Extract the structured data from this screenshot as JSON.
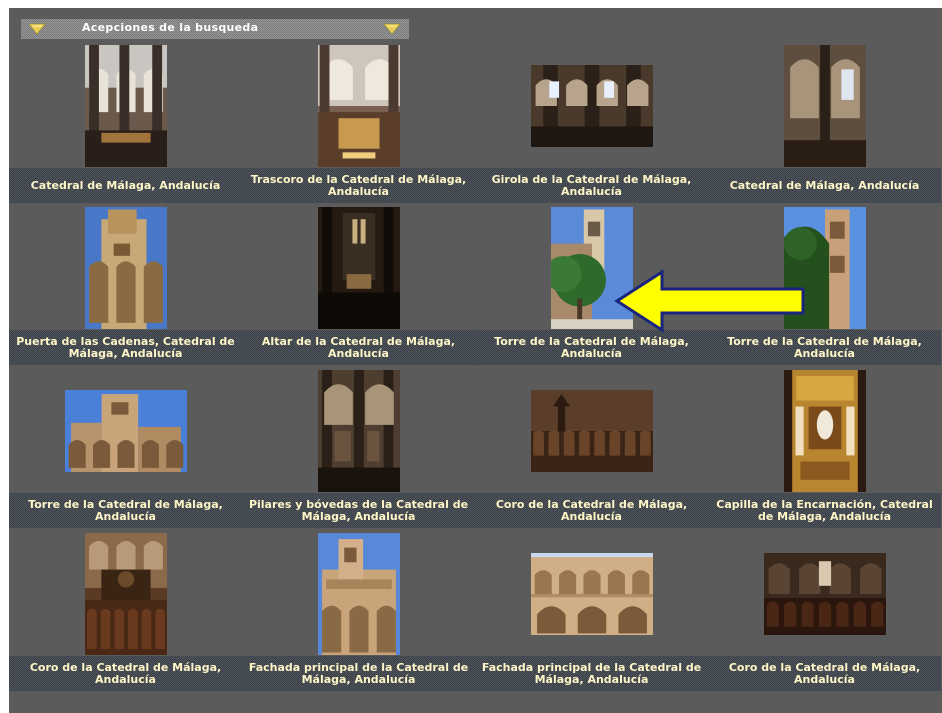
{
  "header": {
    "title": "Acepciones de la busqueda"
  },
  "accent_colors": {
    "caption_text": "#fff6c8",
    "arrow_fill": "#ffff00",
    "arrow_stroke": "#1a237e"
  },
  "results": [
    {
      "caption": "Catedral de Málaga, Andalucía",
      "orientation": "portrait",
      "scene": "interior-nave"
    },
    {
      "caption": "Trascoro de la Catedral de Málaga, Andalucía",
      "orientation": "portrait",
      "scene": "interior-trascoro"
    },
    {
      "caption": "Girola de la Catedral de Málaga, Andalucía",
      "orientation": "landscape",
      "scene": "interior-girola"
    },
    {
      "caption": "Catedral de Málaga, Andalucía",
      "orientation": "portrait",
      "scene": "interior-column"
    },
    {
      "caption": "Puerta de las Cadenas, Catedral de Málaga, Andalucía",
      "orientation": "portrait",
      "scene": "exterior-sky"
    },
    {
      "caption": "Altar de la Catedral de Málaga, Andalucía",
      "orientation": "portrait",
      "scene": "interior-dark"
    },
    {
      "caption": "Torre de la Catedral de Málaga, Andalucía",
      "orientation": "portrait",
      "scene": "tower-trees"
    },
    {
      "caption": "Torre de la Catedral de Málaga, Andalucía",
      "orientation": "portrait",
      "scene": "tower-palm"
    },
    {
      "caption": "Torre de la Catedral de Málaga, Andalucía",
      "orientation": "landscape",
      "scene": "exterior-facade-sky"
    },
    {
      "caption": "Pilares y bóvedas de la Catedral de Málaga, Andalucía",
      "orientation": "portrait",
      "scene": "interior-pillars"
    },
    {
      "caption": "Coro de la Catedral de Málaga, Andalucía",
      "orientation": "landscape",
      "scene": "interior-choir"
    },
    {
      "caption": "Capilla de la Encarnación, Catedral de Málaga, Andalucía",
      "orientation": "portrait",
      "scene": "chapel-gold"
    },
    {
      "caption": "Coro de la Catedral de Málaga, Andalucía",
      "orientation": "portrait",
      "scene": "choir-organ"
    },
    {
      "caption": "Fachada principal de la Catedral de Málaga, Andalucía",
      "orientation": "portrait",
      "scene": "facade-portrait"
    },
    {
      "caption": "Fachada principal de la Catedral de Málaga, Andalucía",
      "orientation": "landscape",
      "scene": "facade-landscape"
    },
    {
      "caption": "Coro de la Catedral de Málaga, Andalucía",
      "orientation": "landscape",
      "scene": "choir-dark"
    }
  ],
  "annotation": {
    "icon": "yellow-arrow-left-icon"
  }
}
